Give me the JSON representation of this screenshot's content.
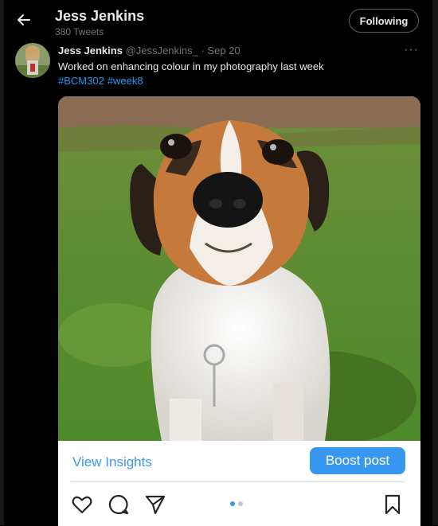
{
  "header": {
    "name": "Jess Jenkins",
    "tweet_count": "380 Tweets",
    "follow_label": "Following",
    "back_icon": "arrow-left-icon"
  },
  "tweet": {
    "author_name": "Jess Jenkins",
    "handle": "@JessJenkins_",
    "separator": "·",
    "date": "Sep 20",
    "more_label": "···",
    "text": "Worked on enhancing colour in my photography last week",
    "hashtags": [
      "#BCM302",
      "#week8"
    ]
  },
  "media": {
    "image_subject": "dog-photo",
    "view_insights_label": "View Insights",
    "boost_label": "Boost post",
    "carousel_total": 2,
    "carousel_active": 1
  },
  "colors": {
    "background": "#000000",
    "text_primary": "#e7e9ea",
    "text_secondary": "#71767b",
    "link_blue": "#1d9bf0",
    "instagram_blue": "#3897f0"
  }
}
